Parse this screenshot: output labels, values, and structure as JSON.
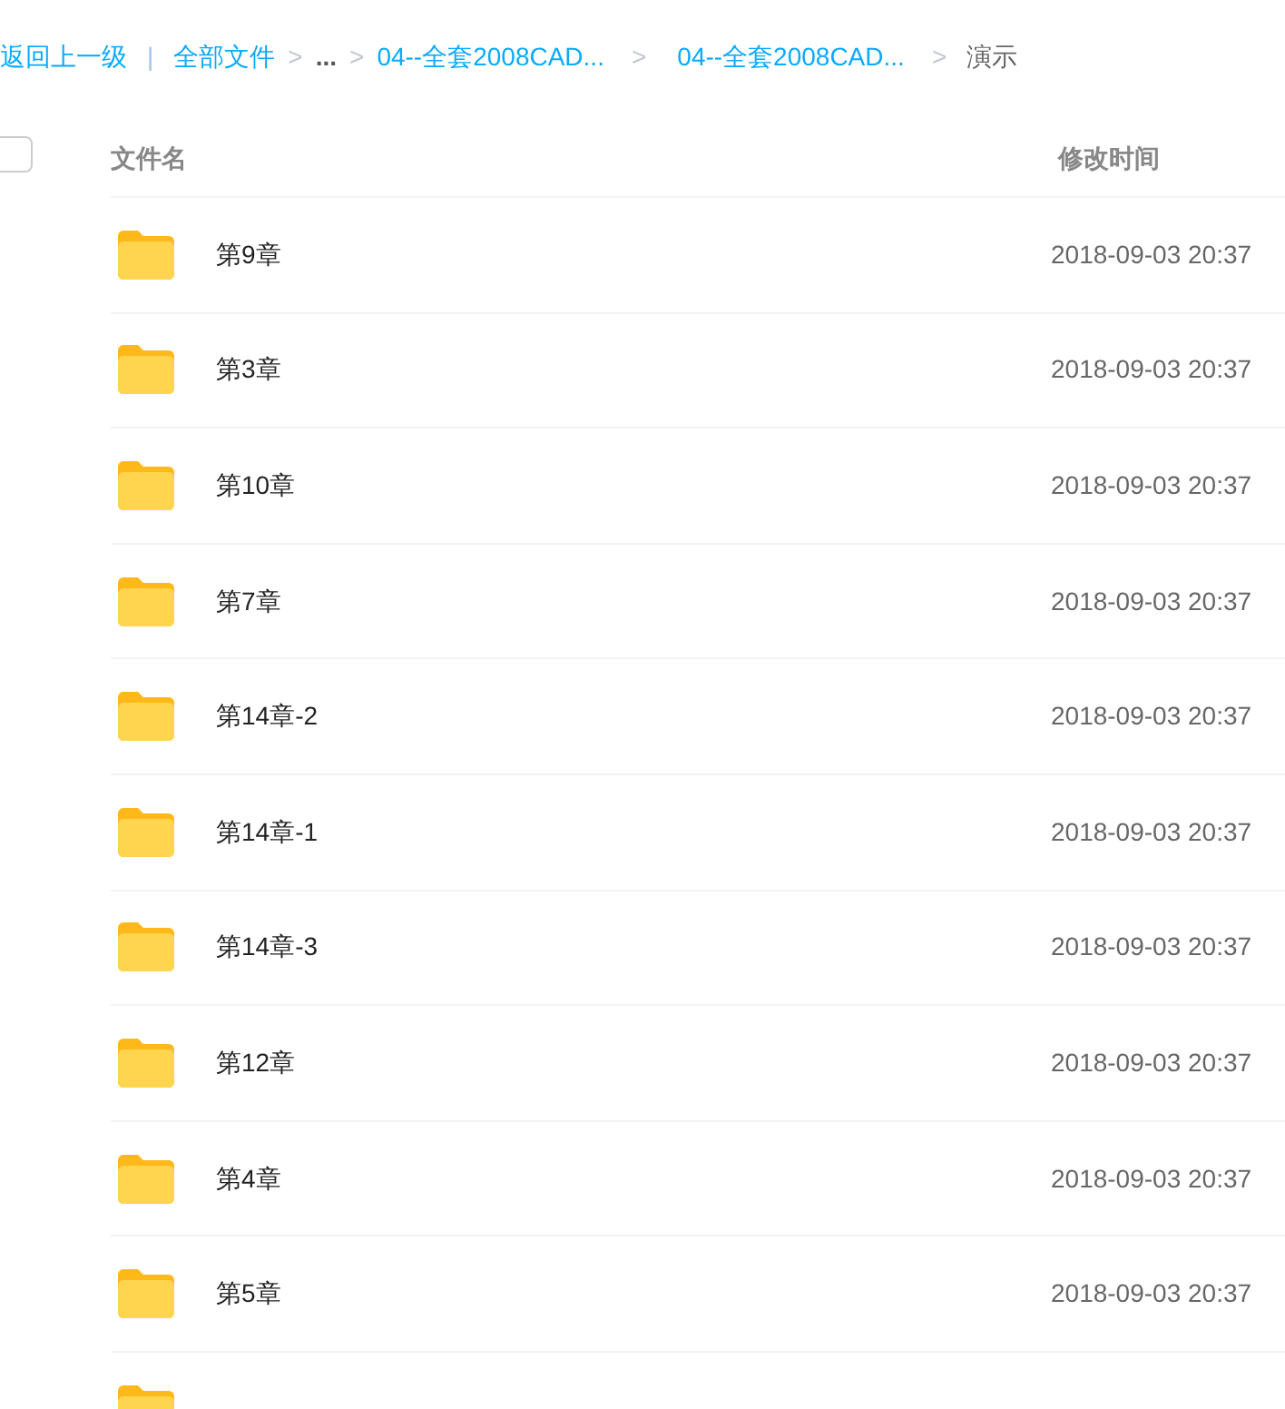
{
  "breadcrumb": {
    "back": "返回上一级",
    "separator": "|",
    "items": [
      {
        "label": "全部文件",
        "current": false
      },
      {
        "label": "...",
        "current": false,
        "kind": "ellipsis"
      },
      {
        "label": "04--全套2008CAD...",
        "current": false
      },
      {
        "label": "04--全套2008CAD...",
        "current": false
      },
      {
        "label": "演示",
        "current": true
      }
    ],
    "arrow": ">"
  },
  "table": {
    "select_all": {
      "checked": false
    },
    "columns": [
      "文件名",
      "修改时间"
    ],
    "rows": [
      {
        "kind": "folder",
        "name": "第9章",
        "modified": "2018-09-03 20:37"
      },
      {
        "kind": "folder",
        "name": "第3章",
        "modified": "2018-09-03 20:37"
      },
      {
        "kind": "folder",
        "name": "第10章",
        "modified": "2018-09-03 20:37"
      },
      {
        "kind": "folder",
        "name": "第7章",
        "modified": "2018-09-03 20:37"
      },
      {
        "kind": "folder",
        "name": "第14章-2",
        "modified": "2018-09-03 20:37"
      },
      {
        "kind": "folder",
        "name": "第14章-1",
        "modified": "2018-09-03 20:37"
      },
      {
        "kind": "folder",
        "name": "第14章-3",
        "modified": "2018-09-03 20:37"
      },
      {
        "kind": "folder",
        "name": "第12章",
        "modified": "2018-09-03 20:37"
      },
      {
        "kind": "folder",
        "name": "第4章",
        "modified": "2018-09-03 20:37"
      },
      {
        "kind": "folder",
        "name": "第5章",
        "modified": "2018-09-03 20:37"
      },
      {
        "kind": "folder"
      }
    ]
  }
}
